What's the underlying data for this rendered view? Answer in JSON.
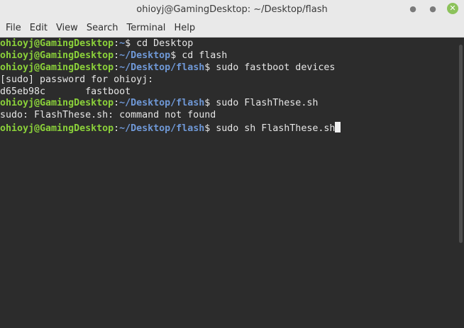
{
  "window": {
    "title": "ohioyj@GamingDesktop: ~/Desktop/flash"
  },
  "menu": [
    "File",
    "Edit",
    "View",
    "Search",
    "Terminal",
    "Help"
  ],
  "terminal": {
    "lines": [
      {
        "user": "ohioyj@GamingDesktop",
        "sep": ":",
        "path": "~",
        "prompt": "$ ",
        "cmd": "cd Desktop"
      },
      {
        "user": "ohioyj@GamingDesktop",
        "sep": ":",
        "path": "~/Desktop",
        "prompt": "$ ",
        "cmd": "cd flash"
      },
      {
        "user": "ohioyj@GamingDesktop",
        "sep": ":",
        "path": "~/Desktop/flash",
        "prompt": "$ ",
        "cmd": "sudo fastboot devices"
      },
      {
        "text": "[sudo] password for ohioyj:"
      },
      {
        "text": "d65eb98c\tfastboot"
      },
      {
        "user": "ohioyj@GamingDesktop",
        "sep": ":",
        "path": "~/Desktop/flash",
        "prompt": "$ ",
        "cmd": "sudo FlashThese.sh"
      },
      {
        "text": "sudo: FlashThese.sh: command not found"
      },
      {
        "user": "ohioyj@GamingDesktop",
        "sep": ":",
        "path": "~/Desktop/flash",
        "prompt": "$ ",
        "cmd": "sudo sh FlashThese.sh"
      }
    ]
  },
  "colors": {
    "user": "#8bd13a",
    "path": "#6f98d6",
    "background": "#2c2c2c"
  }
}
